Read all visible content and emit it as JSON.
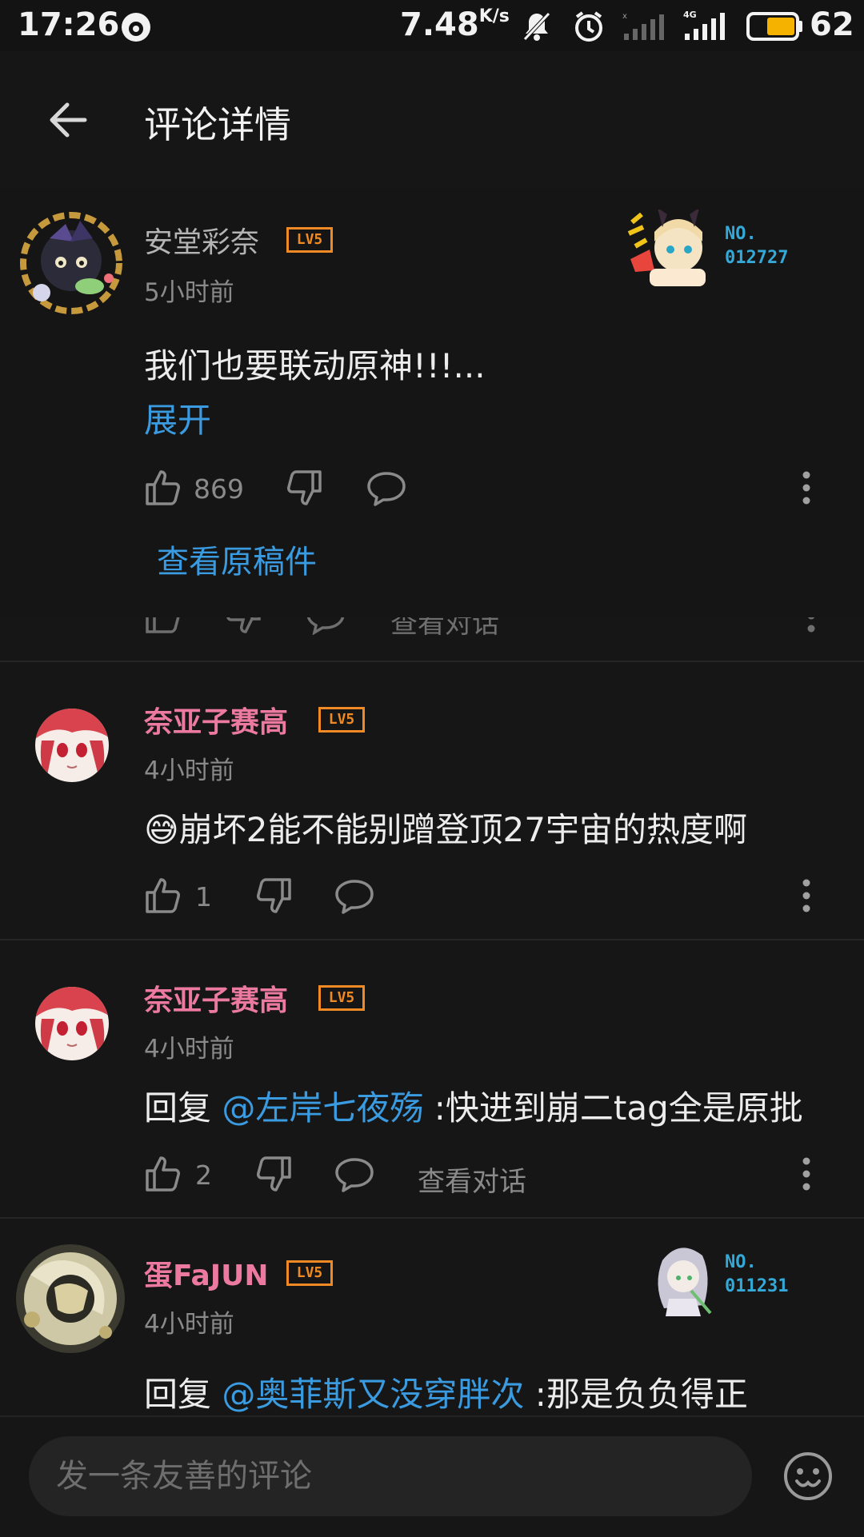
{
  "status_bar": {
    "time": "17:26",
    "speed": "7.48",
    "speed_unit": "K/s",
    "battery": "62"
  },
  "header": {
    "title": "评论详情"
  },
  "main_comment": {
    "username": "安堂彩奈",
    "level": "LV5",
    "time": "5小时前",
    "text": "我们也要联动原神!!!...",
    "expand": "展开",
    "likes": "869",
    "view_original": "查看原稿件",
    "fan_no_label": "NO.",
    "fan_no_value": "012727"
  },
  "peek_row": {
    "conv": "查看对话"
  },
  "comments": [
    {
      "username": "奈亚子赛高",
      "level": "LV5",
      "time": "4小时前",
      "emoji": "😅",
      "text": "崩坏2能不能别蹭登顶27宇宙的热度啊",
      "likes": "1"
    },
    {
      "username": "奈亚子赛高",
      "level": "LV5",
      "time": "4小时前",
      "reply_prefix": "回复 ",
      "mention": "@左岸七夜殇",
      "text": " :快进到崩二tag全是原批",
      "likes": "2",
      "conv": "查看对话"
    },
    {
      "username": "蛋FaJUN",
      "level": "LV5",
      "time": "4小时前",
      "reply_prefix": "回复 ",
      "mention": "@奥菲斯又没穿胖次",
      "text": " :那是负负得正",
      "fan_no_label": "NO.",
      "fan_no_value": "011231"
    }
  ],
  "input": {
    "placeholder": "发一条友善的评论"
  },
  "colors": {
    "background": "#161616",
    "link": "#3a9be0",
    "vip_name": "#ec7aa0",
    "level_badge": "#f08a24",
    "fan_number": "#34a9d8"
  }
}
